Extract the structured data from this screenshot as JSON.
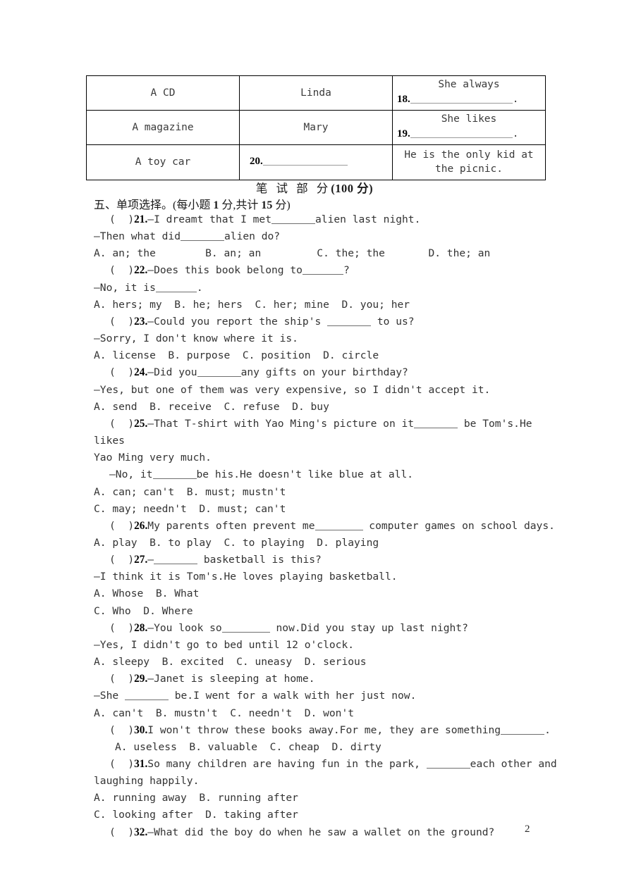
{
  "table": {
    "rows": [
      {
        "item": "A CD",
        "person": "Linda",
        "person_blank": false,
        "sentence_top": "She always",
        "sentence_num": "18.",
        "sentence_tail": "."
      },
      {
        "item": "A magazine",
        "person": "Mary",
        "person_blank": false,
        "sentence_top": "She likes",
        "sentence_num": "19.",
        "sentence_tail": "."
      },
      {
        "item": "A toy car",
        "person_num": "20.",
        "person_blank": true,
        "sentence_full": "He is the only kid at the picnic."
      }
    ]
  },
  "exam_heading": {
    "cn": "笔 试 部 分",
    "score": "(100 分)"
  },
  "section": {
    "label": "五、单项选择。(每小题 ",
    "points_each": "1",
    "mid": " 分,共计 ",
    "points_total": "15",
    "end": " 分)"
  },
  "questions": [
    {
      "num": "21.",
      "stem": "—I dreamt that I met",
      "stem_after": "alien last night.",
      "reply": "—Then what did",
      "reply_after": "alien do?",
      "options": "A. an; the        B. an; an         C. the; the       D. the; an"
    },
    {
      "num": "22.",
      "stem": "—Does this book belong to",
      "stem_after": "?",
      "reply": "—No, it is",
      "reply_after": ".",
      "options": "A. hers; my  B. he; hers  C. her; mine  D. you; her"
    },
    {
      "num": "23.",
      "stem": "—Could you report the ship's ",
      "stem_after": " to us?",
      "reply": "—Sorry, I don't know where it is.",
      "options": "A. license  B. purpose  C. position  D. circle"
    },
    {
      "num": "24.",
      "stem": "—Did you",
      "stem_after": "any gifts on your birthday?",
      "reply": "—Yes, but one of them was very expensive, so I didn't accept it.",
      "options": "A. send  B. receive  C. refuse  D. buy"
    },
    {
      "num": "25.",
      "stem": "—That T-shirt with Yao Ming's picture on it",
      "stem_after": " be Tom's.He likes",
      "wrap": "Yao Ming very much.",
      "reply": "—No, it",
      "reply_after": "be his.He doesn't like blue at all.",
      "options_a": "A. can; can't  B. must; mustn't",
      "options_b": "C. may; needn't  D. must; can't"
    },
    {
      "num": "26.",
      "stem": "My parents often prevent me",
      "stem_after": " computer games on school days.",
      "options": "A. play  B. to play  C. to playing  D. playing"
    },
    {
      "num": "27.",
      "stem": "—",
      "stem_after": " basketball is this?",
      "reply": "—I think it is Tom's.He loves playing basketball.",
      "options_a": "A. Whose  B. What",
      "options_b": "C. Who  D. Where"
    },
    {
      "num": "28.",
      "stem": "—You look so",
      "stem_after": " now.Did you stay up last night?",
      "reply": "—Yes, I didn't go to bed until 12 o'clock.",
      "options": "A. sleepy  B. excited  C. uneasy  D. serious"
    },
    {
      "num": "29.",
      "stem": "—Janet is sleeping at home.",
      "reply": "—She ",
      "reply_after": " be.I went for a walk with her just now.",
      "options": "A. can't  B. mustn't  C. needn't  D. won't"
    },
    {
      "num": "30.",
      "stem": "I won't throw these books away.For me, they are something",
      "stem_after": ".",
      "options": "A. useless  B. valuable  C. cheap  D. dirty"
    },
    {
      "num": "31.",
      "stem": "So many children are having fun in the park, ",
      "stem_after": "each other and",
      "wrap": "laughing happily.",
      "options_a": "A. running away  B. running after",
      "options_b": "C. looking after  D. taking after"
    },
    {
      "num": "32.",
      "stem": "—What did the boy do when he saw a wallet on the ground?"
    }
  ],
  "bracket": "(  )",
  "page_number": "2"
}
